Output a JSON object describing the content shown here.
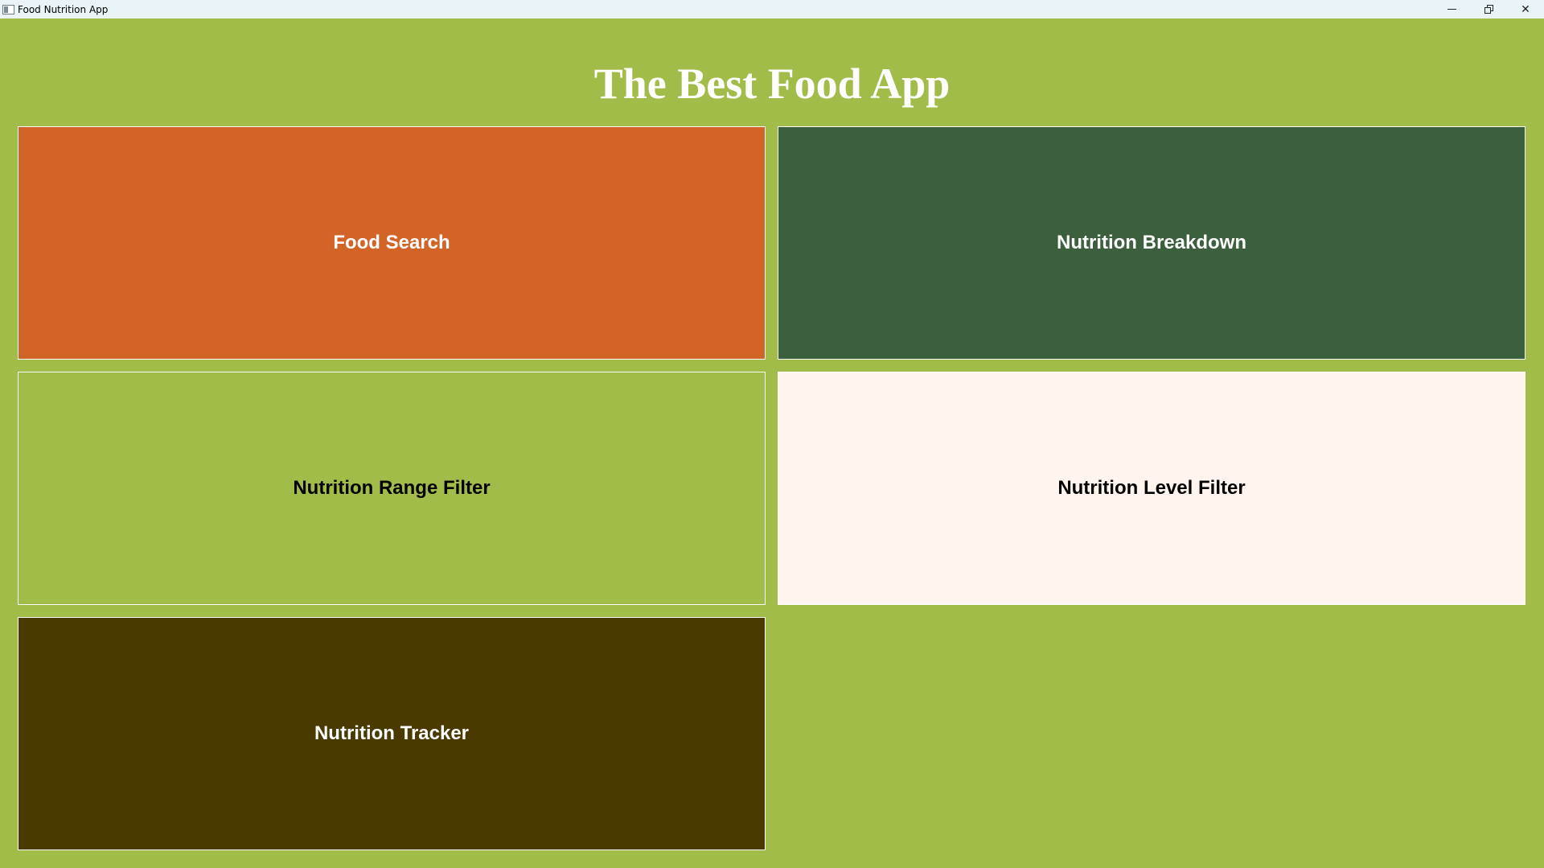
{
  "window": {
    "title": "Food Nutrition App",
    "icon": "app-window-icon",
    "controls": [
      "minimize-icon",
      "restore-icon",
      "close-icon"
    ]
  },
  "header": {
    "title": "The Best Food App"
  },
  "colors": {
    "background": "#a2bc4a",
    "food_search": "#d36428",
    "nutrition_breakdown": "#3c5f3e",
    "nutrition_range_filter": "#a2bc4a",
    "nutrition_level_filter": "#fff5ee",
    "nutrition_tracker": "#4a3a00"
  },
  "tiles": [
    {
      "label": "Food Search"
    },
    {
      "label": "Nutrition Breakdown"
    },
    {
      "label": "Nutrition Range Filter"
    },
    {
      "label": "Nutrition Level Filter"
    },
    {
      "label": "Nutrition Tracker"
    }
  ]
}
